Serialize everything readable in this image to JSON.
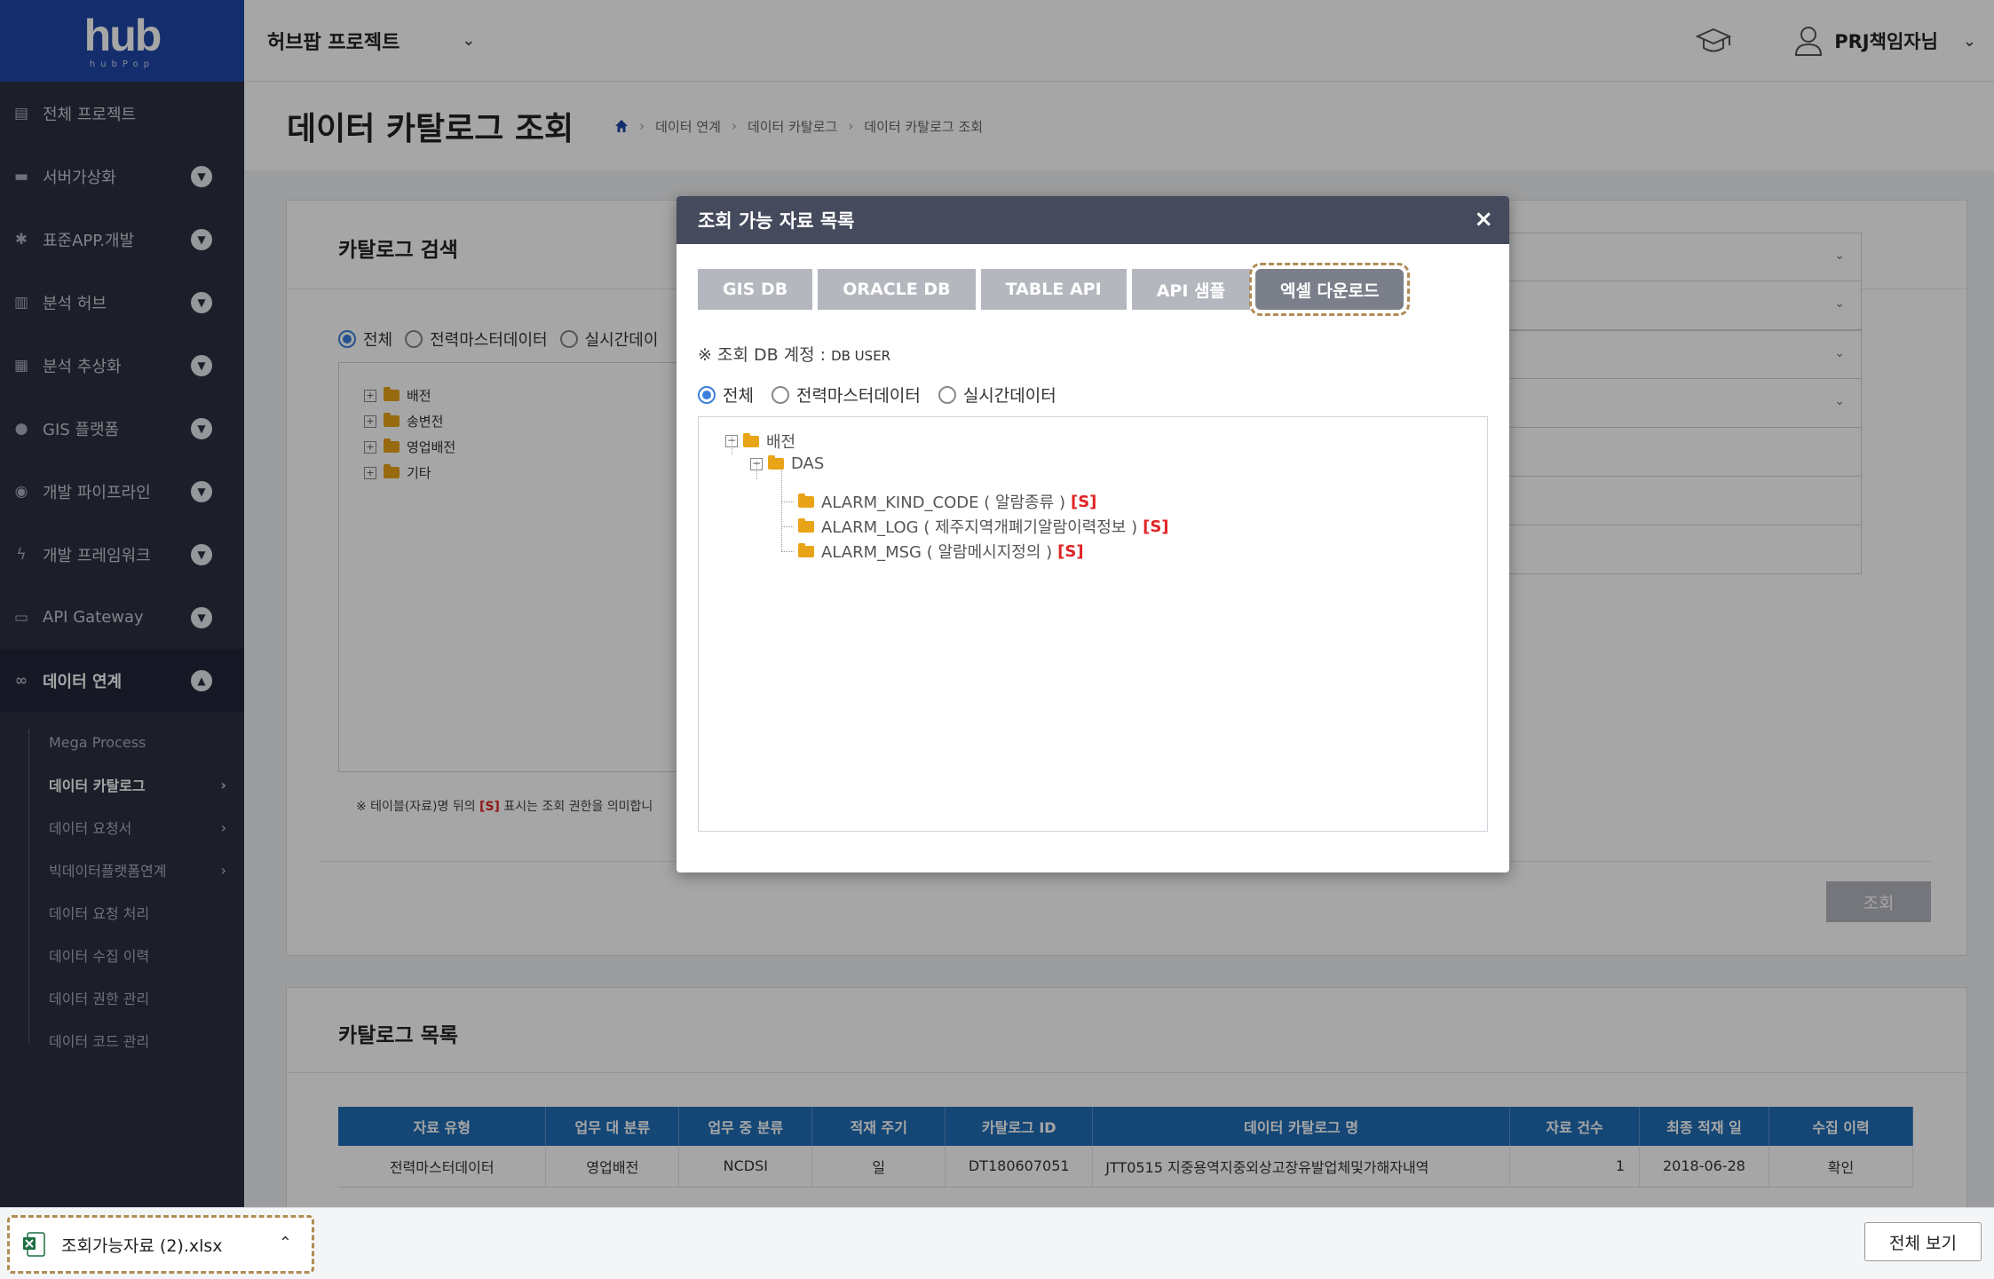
{
  "app": {
    "logo_text": "hub",
    "logo_sub": "hubPop",
    "project_name": "허브팝 프로젝트",
    "user_name": "PRJ책임자님"
  },
  "sidebar": {
    "items": [
      {
        "label": "전체 프로젝트",
        "icon": "document-icon"
      },
      {
        "label": "서버가상화",
        "icon": "server-icon"
      },
      {
        "label": "표준APP.개발",
        "icon": "network-icon"
      },
      {
        "label": "분석 허브",
        "icon": "chart-icon"
      },
      {
        "label": "분석 추상화",
        "icon": "layers-icon"
      },
      {
        "label": "GIS 플랫폼",
        "icon": "map-pin-icon"
      },
      {
        "label": "개발 파이프라인",
        "icon": "pipeline-icon"
      },
      {
        "label": "개발 프레임워크",
        "icon": "framework-icon"
      },
      {
        "label": "API Gateway",
        "icon": "monitor-icon"
      },
      {
        "label": "데이터 연계",
        "icon": "link-icon"
      }
    ],
    "sub_items": [
      {
        "label": "Mega Process"
      },
      {
        "label": "데이터 카탈로그"
      },
      {
        "label": "데이터 요청서"
      },
      {
        "label": "빅데이터플랫폼연계"
      },
      {
        "label": "데이터 요청 처리"
      },
      {
        "label": "데이터 수집 이력"
      },
      {
        "label": "데이터 권한 관리"
      },
      {
        "label": "데이터 코드 관리"
      }
    ]
  },
  "page": {
    "title": "데이터 카탈로그 조회",
    "breadcrumb": [
      "데이터 연계",
      "데이터 카탈로그",
      "데이터 카탈로그 조회"
    ]
  },
  "search_panel": {
    "title": "카탈로그 검색",
    "radios": [
      "전체",
      "전력마스터데이터",
      "실시간데이"
    ],
    "tree": [
      "배전",
      "송변전",
      "영업배전",
      "기타"
    ],
    "note_prefix": "※ 테이블(자료)명 뒤의 ",
    "note_s": "[S]",
    "note_suffix": " 표시는 조회 권한을 의미합니",
    "search_button": "조회"
  },
  "list_panel": {
    "title": "카탈로그 목록",
    "headers": [
      "자료 유형",
      "업무 대 분류",
      "업무 중 분류",
      "적재 주기",
      "카탈로그 ID",
      "데이터 카탈로그 명",
      "자료 건수",
      "최종 적재 일",
      "수집 이력"
    ],
    "rows": [
      [
        "전력마스터데이터",
        "영업배전",
        "NCDSI",
        "일",
        "DT180607051",
        "JTT0515 지중용역지중외상고장유발업체및가해자내역",
        "1",
        "2018-06-28",
        "확인"
      ]
    ]
  },
  "modal": {
    "title": "조회 가능 자료 목록",
    "close": "×",
    "tabs": [
      "GIS DB",
      "ORACLE DB",
      "TABLE API",
      "API 샘플",
      "엑셀 다운로드"
    ],
    "db_account_label": "※ 조회 DB 계정 :",
    "db_account_value": "DB USER",
    "radios": [
      "전체",
      "전력마스터데이터",
      "실시간데이터"
    ],
    "tree": {
      "root": "배전",
      "child": "DAS",
      "leaves": [
        {
          "label": "ALARM_KIND_CODE ( 알람종류 )",
          "tag": "[S]"
        },
        {
          "label": "ALARM_LOG ( 제주지역개폐기알람이력정보 )",
          "tag": "[S]"
        },
        {
          "label": "ALARM_MSG ( 알람메시지정의 )",
          "tag": "[S]"
        }
      ]
    }
  },
  "download_bar": {
    "file_name": "조회가능자료 (2).xlsx",
    "show_all": "전체 보기"
  },
  "colors": {
    "brand": "#1f47a8",
    "sidebar_bg": "#2c3040",
    "table_header": "#1f6db6",
    "modal_header": "#454a5c",
    "tag_red": "#e02424",
    "folder": "#e8a317"
  }
}
